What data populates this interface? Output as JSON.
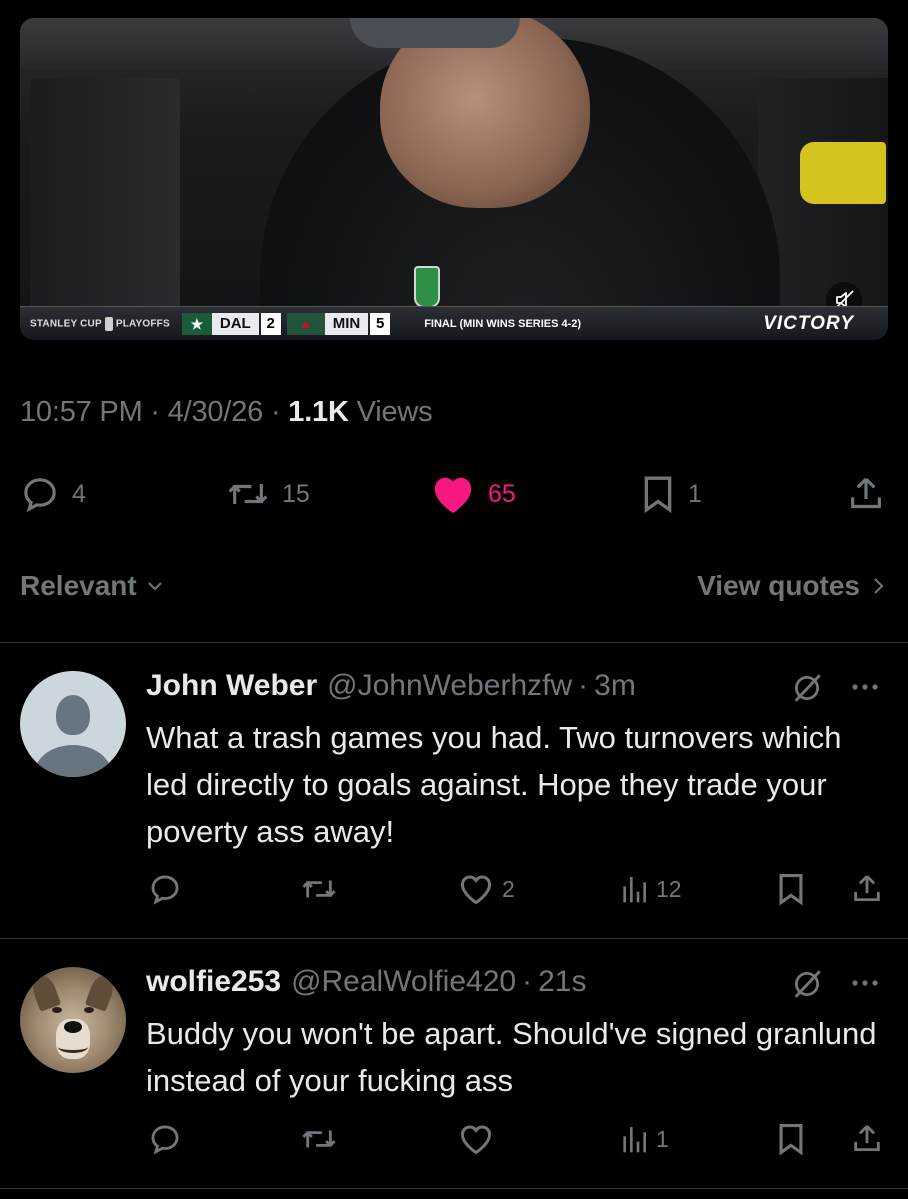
{
  "video": {
    "scorebug": {
      "series_label": "STANLEY CUP",
      "playoffs_label": "PLAYOFFS",
      "team1": "DAL",
      "team1_score": "2",
      "team2": "MIN",
      "team2_score": "5",
      "status": "FINAL (MIN WINS SERIES 4-2)",
      "brand": "VICTORY"
    },
    "mute_icon": "speaker-muted-icon"
  },
  "post": {
    "time": "10:57 PM",
    "date": "4/30/26",
    "views_count": "1.1K",
    "views_label": "Views",
    "sep": "·"
  },
  "actions": {
    "replies": "4",
    "reposts": "15",
    "likes": "65",
    "bookmarks": "1",
    "like_color": "#f91880"
  },
  "sort": {
    "label": "Relevant",
    "view_quotes": "View quotes"
  },
  "replies": [
    {
      "name": "John Weber",
      "handle": "@JohnWeberhzfw",
      "time": "3m",
      "text": "What a trash games you had. Two turnovers which led directly to goals against. Hope they trade your poverty ass away!",
      "likes": "2",
      "views": "12"
    },
    {
      "name": "wolfie253",
      "handle": "@RealWolfie420",
      "time": "21s",
      "text": "Buddy you won't be apart. Should've signed granlund instead of your fucking ass",
      "likes": "",
      "views": "1"
    }
  ]
}
